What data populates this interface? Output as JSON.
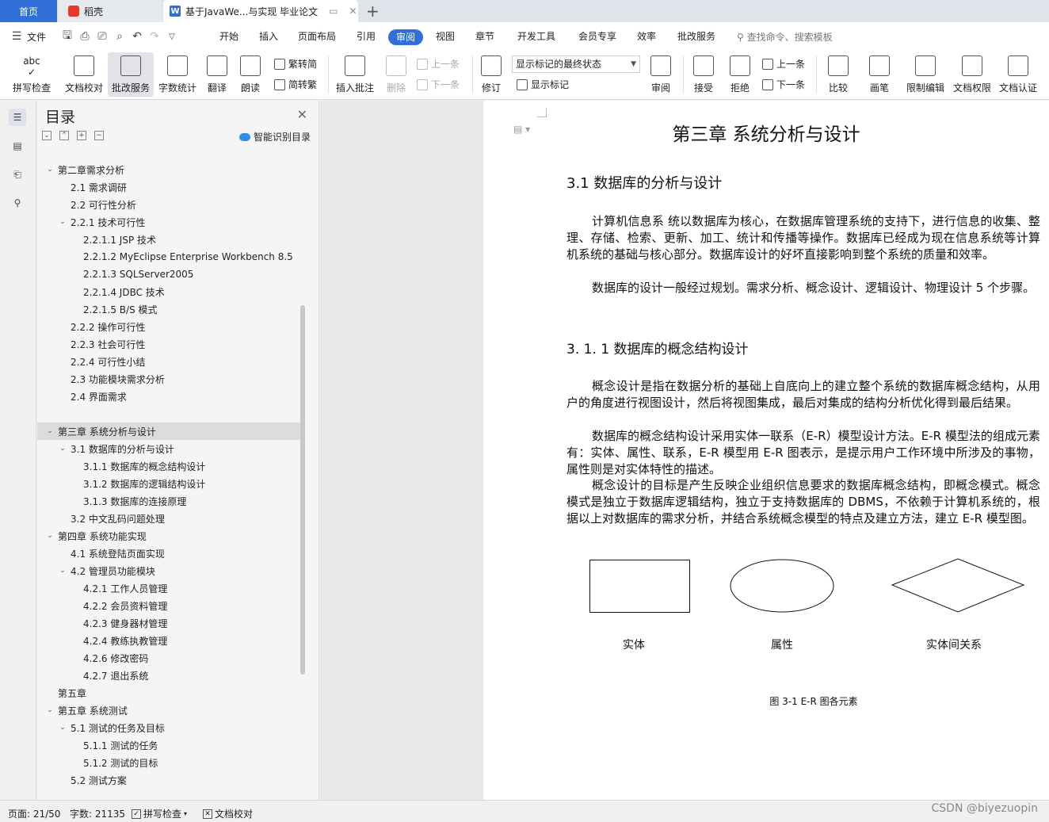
{
  "tabs": {
    "home": "首页",
    "daoke": "稻壳",
    "doc": "基于JavaWe...与实现 毕业论文"
  },
  "menu": {
    "file": "文件",
    "items": [
      "开始",
      "插入",
      "页面布局",
      "引用",
      "审阅",
      "视图",
      "章节",
      "开发工具",
      "会员专享",
      "效率",
      "批改服务"
    ],
    "active": "审阅",
    "search": "查找命令、搜索模板"
  },
  "ribbon": {
    "spell": "拼写检查",
    "proofread": "文档校对",
    "correct": "批改服务",
    "wordcount": "字数统计",
    "translate": "翻译",
    "read": "朗读",
    "trad": "繁转简",
    "simp": "简转繁",
    "insert_comment": "插入批注",
    "delete": "删除",
    "prev": "上一条",
    "next": "下一条",
    "track": "修订",
    "markup_select": "显示标记的最终状态",
    "show_markup": "显示标记",
    "review": "审阅",
    "accept": "接受",
    "reject": "拒绝",
    "prev2": "上一条",
    "next2": "下一条",
    "compare": "比较",
    "pen": "画笔",
    "restrict": "限制编辑",
    "permission": "文档权限",
    "certify": "文档认证"
  },
  "toc": {
    "title": "目录",
    "smart": "智能识别目录",
    "items": [
      {
        "text": "第二章需求分析",
        "level": 0,
        "arrow": "open"
      },
      {
        "text": "2.1  需求调研",
        "level": 1,
        "arrow": ""
      },
      {
        "text": "2.2  可行性分析",
        "level": 1,
        "arrow": ""
      },
      {
        "text": "2.2.1 技术可行性",
        "level": 1,
        "arrow": "open"
      },
      {
        "text": "2.2.1.1 JSP 技术",
        "level": 2,
        "arrow": ""
      },
      {
        "text": "2.2.1.2 MyEclipse Enterprise Workbench 8.5",
        "level": 2,
        "arrow": ""
      },
      {
        "text": "2.2.1.3 SQLServer2005",
        "level": 2,
        "arrow": ""
      },
      {
        "text": "2.2.1.4 JDBC 技术",
        "level": 2,
        "arrow": ""
      },
      {
        "text": "2.2.1.5 B/S 模式",
        "level": 2,
        "arrow": ""
      },
      {
        "text": "2.2.2  操作可行性",
        "level": 1,
        "arrow": ""
      },
      {
        "text": "2.2.3  社会可行性",
        "level": 1,
        "arrow": ""
      },
      {
        "text": "2.2.4  可行性小结",
        "level": 1,
        "arrow": ""
      },
      {
        "text": "2.3  功能模块需求分析",
        "level": 1,
        "arrow": ""
      },
      {
        "text": "2.4  界面需求",
        "level": 1,
        "arrow": ""
      },
      {
        "text": "",
        "level": 1,
        "arrow": ""
      },
      {
        "text": "第三章  系统分析与设计",
        "level": 0,
        "arrow": "open",
        "selected": true
      },
      {
        "text": "3.1  数据库的分析与设计",
        "level": 1,
        "arrow": "open"
      },
      {
        "text": "3.1.1 数据库的概念结构设计",
        "level": 2,
        "arrow": ""
      },
      {
        "text": "3.1.2 数据库的逻辑结构设计",
        "level": 2,
        "arrow": ""
      },
      {
        "text": "3.1.3  数据库的连接原理",
        "level": 2,
        "arrow": ""
      },
      {
        "text": "3.2 中文乱码问题处理",
        "level": 1,
        "arrow": ""
      },
      {
        "text": "第四章  系统功能实现",
        "level": 0,
        "arrow": "open"
      },
      {
        "text": "4.1 系统登陆页面实现",
        "level": 1,
        "arrow": ""
      },
      {
        "text": "4.2  管理员功能模块",
        "level": 1,
        "arrow": "open"
      },
      {
        "text": "4.2.1  工作人员管理",
        "level": 2,
        "arrow": ""
      },
      {
        "text": "4.2.2 会员资料管理",
        "level": 2,
        "arrow": ""
      },
      {
        "text": "4.2.3 健身器材管理",
        "level": 2,
        "arrow": ""
      },
      {
        "text": "4.2.4  教练执教管理",
        "level": 2,
        "arrow": ""
      },
      {
        "text": "4.2.6  修改密码",
        "level": 2,
        "arrow": ""
      },
      {
        "text": "4.2.7  退出系统",
        "level": 2,
        "arrow": ""
      },
      {
        "text": "第五章",
        "level": 0,
        "arrow": ""
      },
      {
        "text": "第五章  系统测试",
        "level": 0,
        "arrow": "open"
      },
      {
        "text": "5.1  测试的任务及目标",
        "level": 1,
        "arrow": "open"
      },
      {
        "text": "5.1.1  测试的任务",
        "level": 2,
        "arrow": ""
      },
      {
        "text": "5.1.2  测试的目标",
        "level": 2,
        "arrow": ""
      },
      {
        "text": "5.2  测试方案",
        "level": 1,
        "arrow": ""
      }
    ]
  },
  "doc": {
    "chapter_title": "第三章  系统分析与设计",
    "h2": "3.1  数据库的分析与设计",
    "p1": "计算机信息系  统以数据库为核心，在数据库管理系统的支持下，进行信息的收集、整理、存储、检索、更新、加工、统计和传播等操作。数据库已经成为现在信息系统等计算机系统的基础与核心部分。数据库设计的好坏直接影响到整个系统的质量和效率。",
    "p2": "数据库的设计一般经过规划。需求分析、概念设计、逻辑设计、物理设计 5 个步骤。",
    "h3": "3. 1. 1 数据库的概念结构设计",
    "p3": "概念设计是指在数据分析的基础上自底向上的建立整个系统的数据库概念结构，从用户的角度进行视图设计，然后将视图集成，最后对集成的结构分析优化得到最后结果。",
    "p4": "数据库的概念结构设计采用实体一联系（E-R）模型设计方法。E-R 模型法的组成元素有：实体、属性、联系，E-R 模型用 E-R 图表示，是提示用户工作环境中所涉及的事物，属性则是对实体特性的描述。",
    "p5": "概念设计的目标是产生反映企业组织信息要求的数据库概念结构，即概念模式。概念模式是独立于数据库逻辑结构，独立于支持数据库的 DBMS，不依赖于计算机系统的，根据以上对数据库的需求分析，并结合系统概念模型的特点及建立方法，建立 E-R 模型图。",
    "fig_entity": "实体",
    "fig_attr": "属性",
    "fig_rel": "实体间关系",
    "fig_caption": "图 3-1  E-R 图各元素"
  },
  "status": {
    "page": "页面: 21/50",
    "words": "字数: 21135",
    "spell": "拼写检查",
    "proof": "文档校对"
  },
  "watermark": "CSDN @biyezuopin"
}
